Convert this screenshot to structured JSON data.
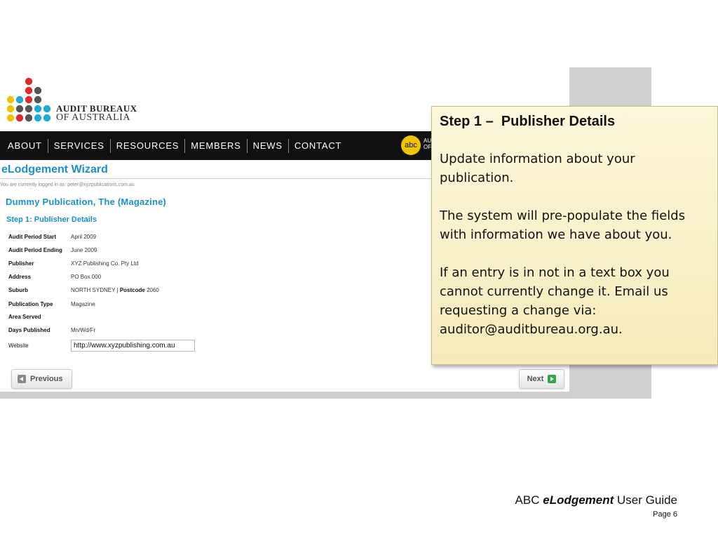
{
  "logo": {
    "line1": "AUDIT BUREAUX",
    "line2": "OF AUSTRALIA"
  },
  "nav": {
    "items": [
      "ABOUT",
      "SERVICES",
      "RESOURCES",
      "MEMBERS",
      "NEWS",
      "CONTACT"
    ],
    "badge": "abc",
    "badge_text": "AUDIT OF"
  },
  "wizard": {
    "title": "eLodgement Wizard",
    "login_line": "You are currently logged in as: peter@xyzpublications.com.au",
    "publication_title": "Dummy Publication, The (Magazine)",
    "step_title": "Step 1: Publisher Details",
    "details": [
      {
        "label": "Audit Period Start",
        "value": "April 2009"
      },
      {
        "label": "Audit Period Ending",
        "value": "June 2009"
      },
      {
        "label": "Publisher",
        "value": "XYZ Publishing Co. Pty Ltd"
      },
      {
        "label": "Address",
        "value": "PO Box 000"
      },
      {
        "label": "Suburb",
        "value": "NORTH SYDNEY |",
        "extra_label": "Postcode",
        "extra_value": "2060"
      },
      {
        "label": "Publication Type",
        "value": "Magazine"
      },
      {
        "label": "Area Served",
        "value": ""
      },
      {
        "label": "Days Published",
        "value": "Mn/Wd/Fr"
      }
    ],
    "website": {
      "label": "Website",
      "value": "http://www.xyzpublishing.com.au"
    },
    "prev_label": "Previous",
    "next_label": "Next"
  },
  "note": {
    "title": "Step 1 –  Publisher Details",
    "paragraphs": [
      "Update information about your publication.",
      "The system will pre-populate the fields with information we have about you.",
      "If an entry is in not in a text box you cannot currently change it.  Email us requesting a change via: auditor@auditbureau.org.au."
    ]
  },
  "footer": {
    "prefix": "ABC ",
    "brand": "eLodgement",
    "suffix": " User Guide",
    "page": "Page 6"
  },
  "colors": {
    "accent_blue": "#1a8fc8",
    "nav_background": "#111111",
    "note_background": "#f8efc6",
    "badge_yellow": "#f2c400"
  }
}
